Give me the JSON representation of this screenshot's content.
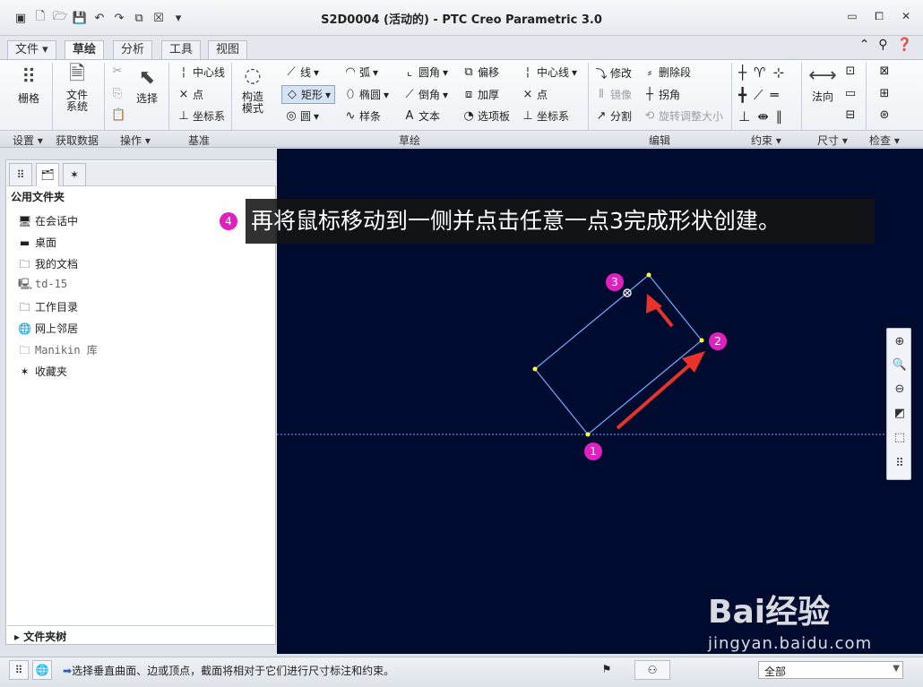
{
  "title": "S2D0004 (活动的) - PTC Creo Parametric 3.0",
  "tabs": [
    {
      "label": "文件 ▾"
    },
    {
      "label": "草绘"
    },
    {
      "label": "分析"
    },
    {
      "label": "工具"
    },
    {
      "label": "视图"
    }
  ],
  "ribbon": {
    "grid": "栅格",
    "file_system": "文件\n系统",
    "file_system_l1": "文件",
    "file_system_l2": "系统",
    "select": "选择",
    "centerline": "中心线",
    "point": "点",
    "coord_sys": "坐标系",
    "construct_mode_l1": "构造",
    "construct_mode_l2": "模式",
    "line": "线",
    "rectangle": "矩形",
    "circle": "圆",
    "arc": "弧",
    "ellipse": "椭圆",
    "spline": "样条",
    "fillet": "圆角",
    "chamfer": "倒角",
    "text": "文本",
    "offset": "偏移",
    "thicken": "加厚",
    "palette": "选项板",
    "centerline2": "中心线",
    "point2": "点",
    "coord_sys2": "坐标系",
    "modify": "修改",
    "delete_segment": "删除段",
    "mirror": "镜像",
    "corner": "拐角",
    "divide": "分割",
    "rotate_resize": "旋转调整大小",
    "normal": "法向"
  },
  "groups": {
    "settings": "设置 ▾",
    "get_data": "获取数据",
    "operations": "操作 ▾",
    "datum": "基准",
    "sketching": "草绘",
    "editing": "编辑",
    "constrain": "约束 ▾",
    "dimension": "尺寸 ▾",
    "inspect": "检查 ▾"
  },
  "panel": {
    "header": "公用文件夹",
    "items": [
      {
        "label": "在会话中",
        "icon": "monitor-icon"
      },
      {
        "label": "桌面",
        "icon": "desktop-icon"
      },
      {
        "label": "我的文档",
        "icon": "documents-icon"
      },
      {
        "label": "td-15",
        "icon": "computer-icon"
      },
      {
        "label": "工作目录",
        "icon": "work-folder-icon"
      },
      {
        "label": "网上邻居",
        "icon": "network-icon"
      },
      {
        "label": "Manikin 库",
        "icon": "library-folder-icon"
      },
      {
        "label": "收藏夹",
        "icon": "favorites-icon"
      }
    ],
    "tree": "文件夹树"
  },
  "annotation": {
    "step4": "4",
    "text": "再将鼠标移动到一侧并点击任意一点3完成形状创建。",
    "step1": "1",
    "step2": "2",
    "step3": "3"
  },
  "status": {
    "message": "选择垂直曲面、边或顶点，截面将相对于它们进行尺寸标注和约束。",
    "filter": "全部"
  },
  "watermark": {
    "brand": "Bai经验",
    "url": "jingyan.baidu.com"
  },
  "colors": {
    "canvas": "#000c2f",
    "sketch_line": "#6fa8ff",
    "vertex": "#ffff40",
    "step_marker": "#e020c0",
    "arrow": "#e8332a"
  }
}
